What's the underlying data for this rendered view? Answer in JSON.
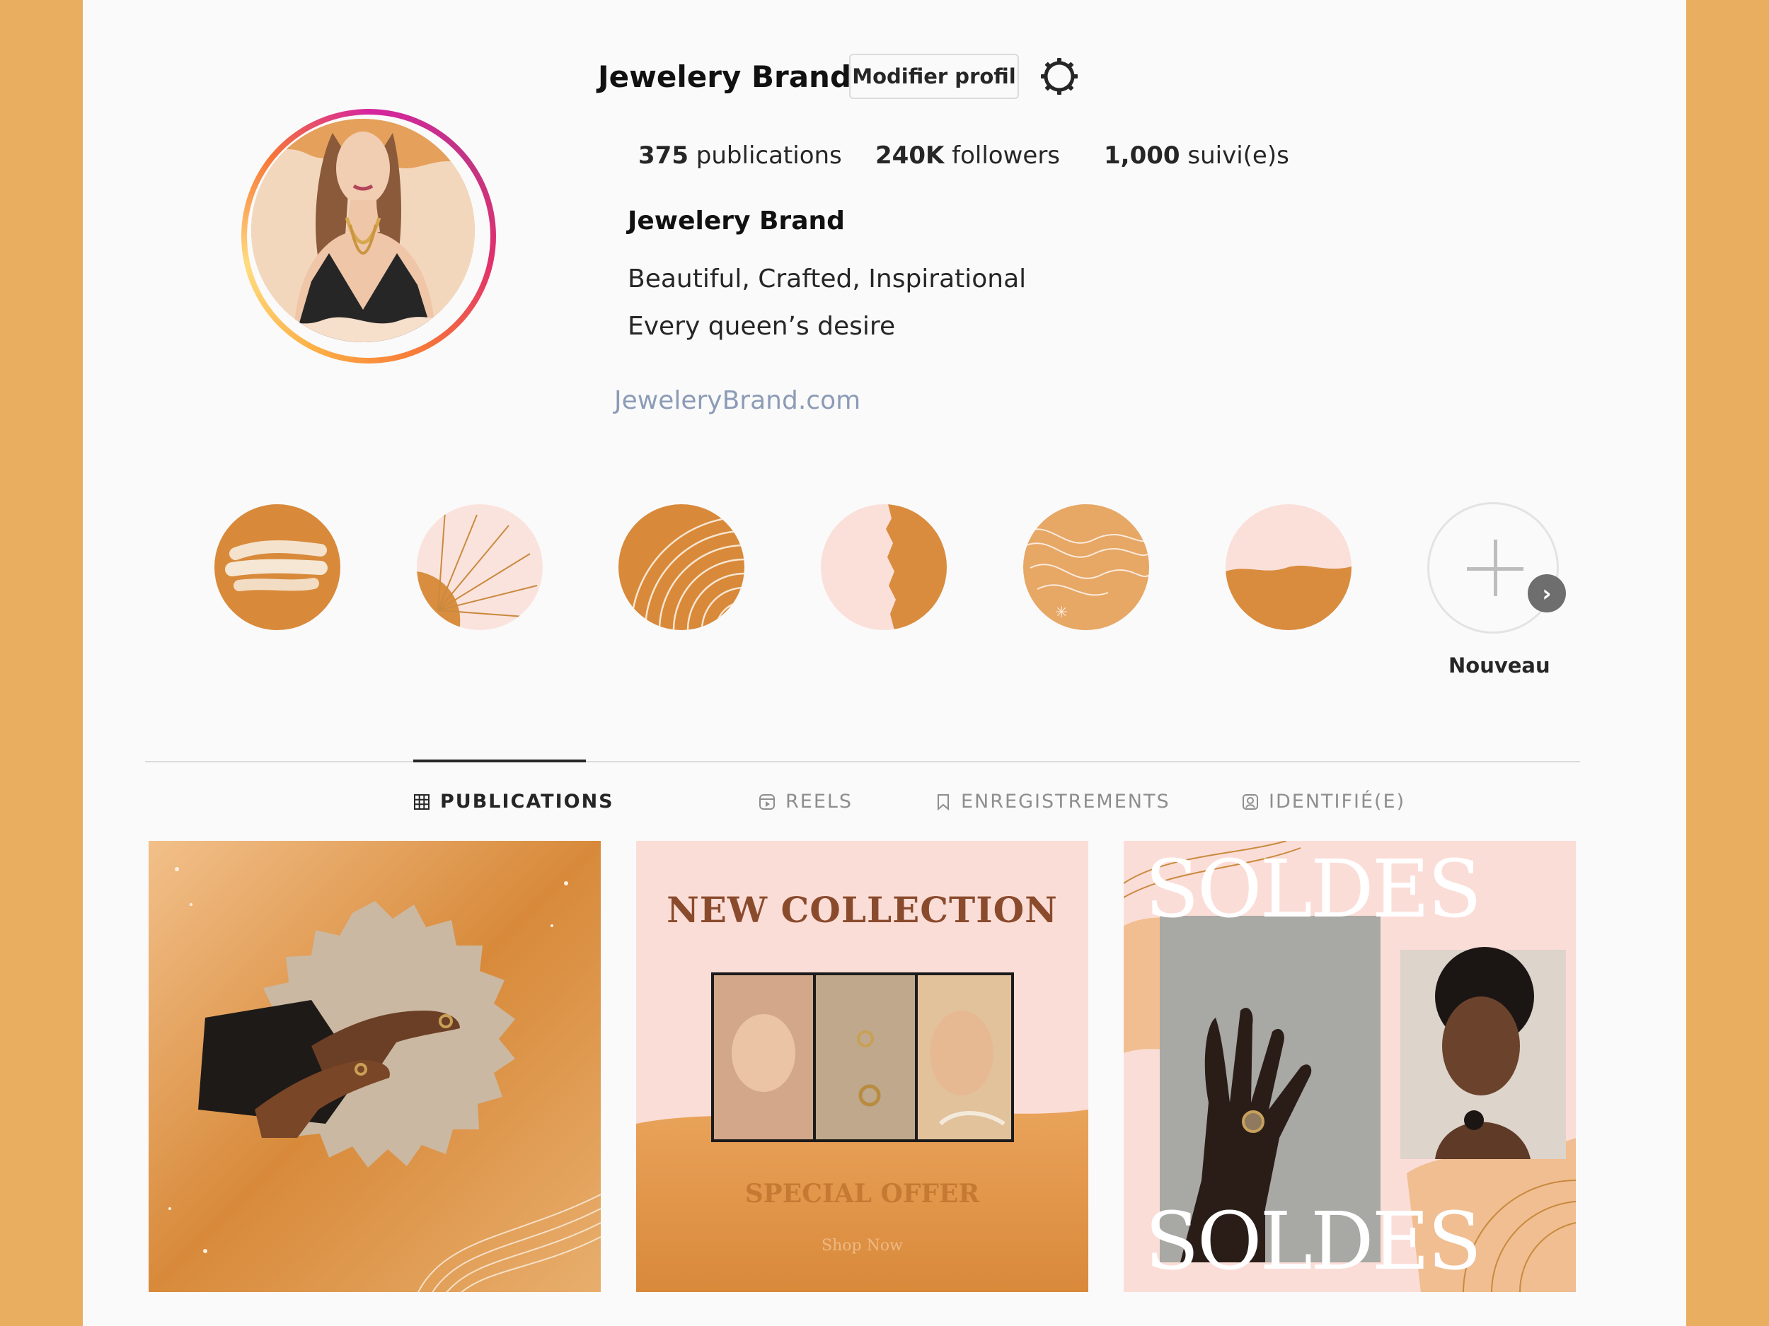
{
  "profile": {
    "username": "Jewelery Brand",
    "edit_label": "Modifier profil",
    "settings_icon": "gear-icon",
    "stats": {
      "posts_count": "375",
      "posts_label": "publications",
      "followers_count": "240K",
      "followers_label": "followers",
      "following_count": "1,000",
      "following_label": "suivi(e)s"
    },
    "display_name": "Jewelery Brand",
    "bio_line1": "Beautiful, Crafted, Inspirational",
    "bio_line2": "Every queen’s desire",
    "website": "JeweleryBrand.com"
  },
  "highlights": {
    "items": [
      "paint-strokes",
      "sun-rays",
      "arc-lines",
      "torn-edge",
      "wave-lines",
      "paint-wash"
    ],
    "new_label": "Nouveau"
  },
  "tabs": [
    {
      "label": "PUBLICATIONS",
      "icon": "grid-icon",
      "active": true
    },
    {
      "label": "REELS",
      "icon": "reels-icon",
      "active": false
    },
    {
      "label": "ENREGISTREMENTS",
      "icon": "bookmark-icon",
      "active": false
    },
    {
      "label": "IDENTIFIÉ(E)",
      "icon": "tagged-icon",
      "active": false
    }
  ],
  "posts": {
    "post2": {
      "title": "NEW COLLECTION",
      "offer": "SPECIAL OFFER",
      "cta": "Shop Now"
    },
    "post3": {
      "top_text": "SOLDES",
      "bottom_text": "SOLDES"
    }
  },
  "colors": {
    "background": "#E9AE5F",
    "page": "#FAFAFA",
    "gold": "#D78A37",
    "blush": "#FBDDD7",
    "brown_title": "#8A4B2D"
  }
}
